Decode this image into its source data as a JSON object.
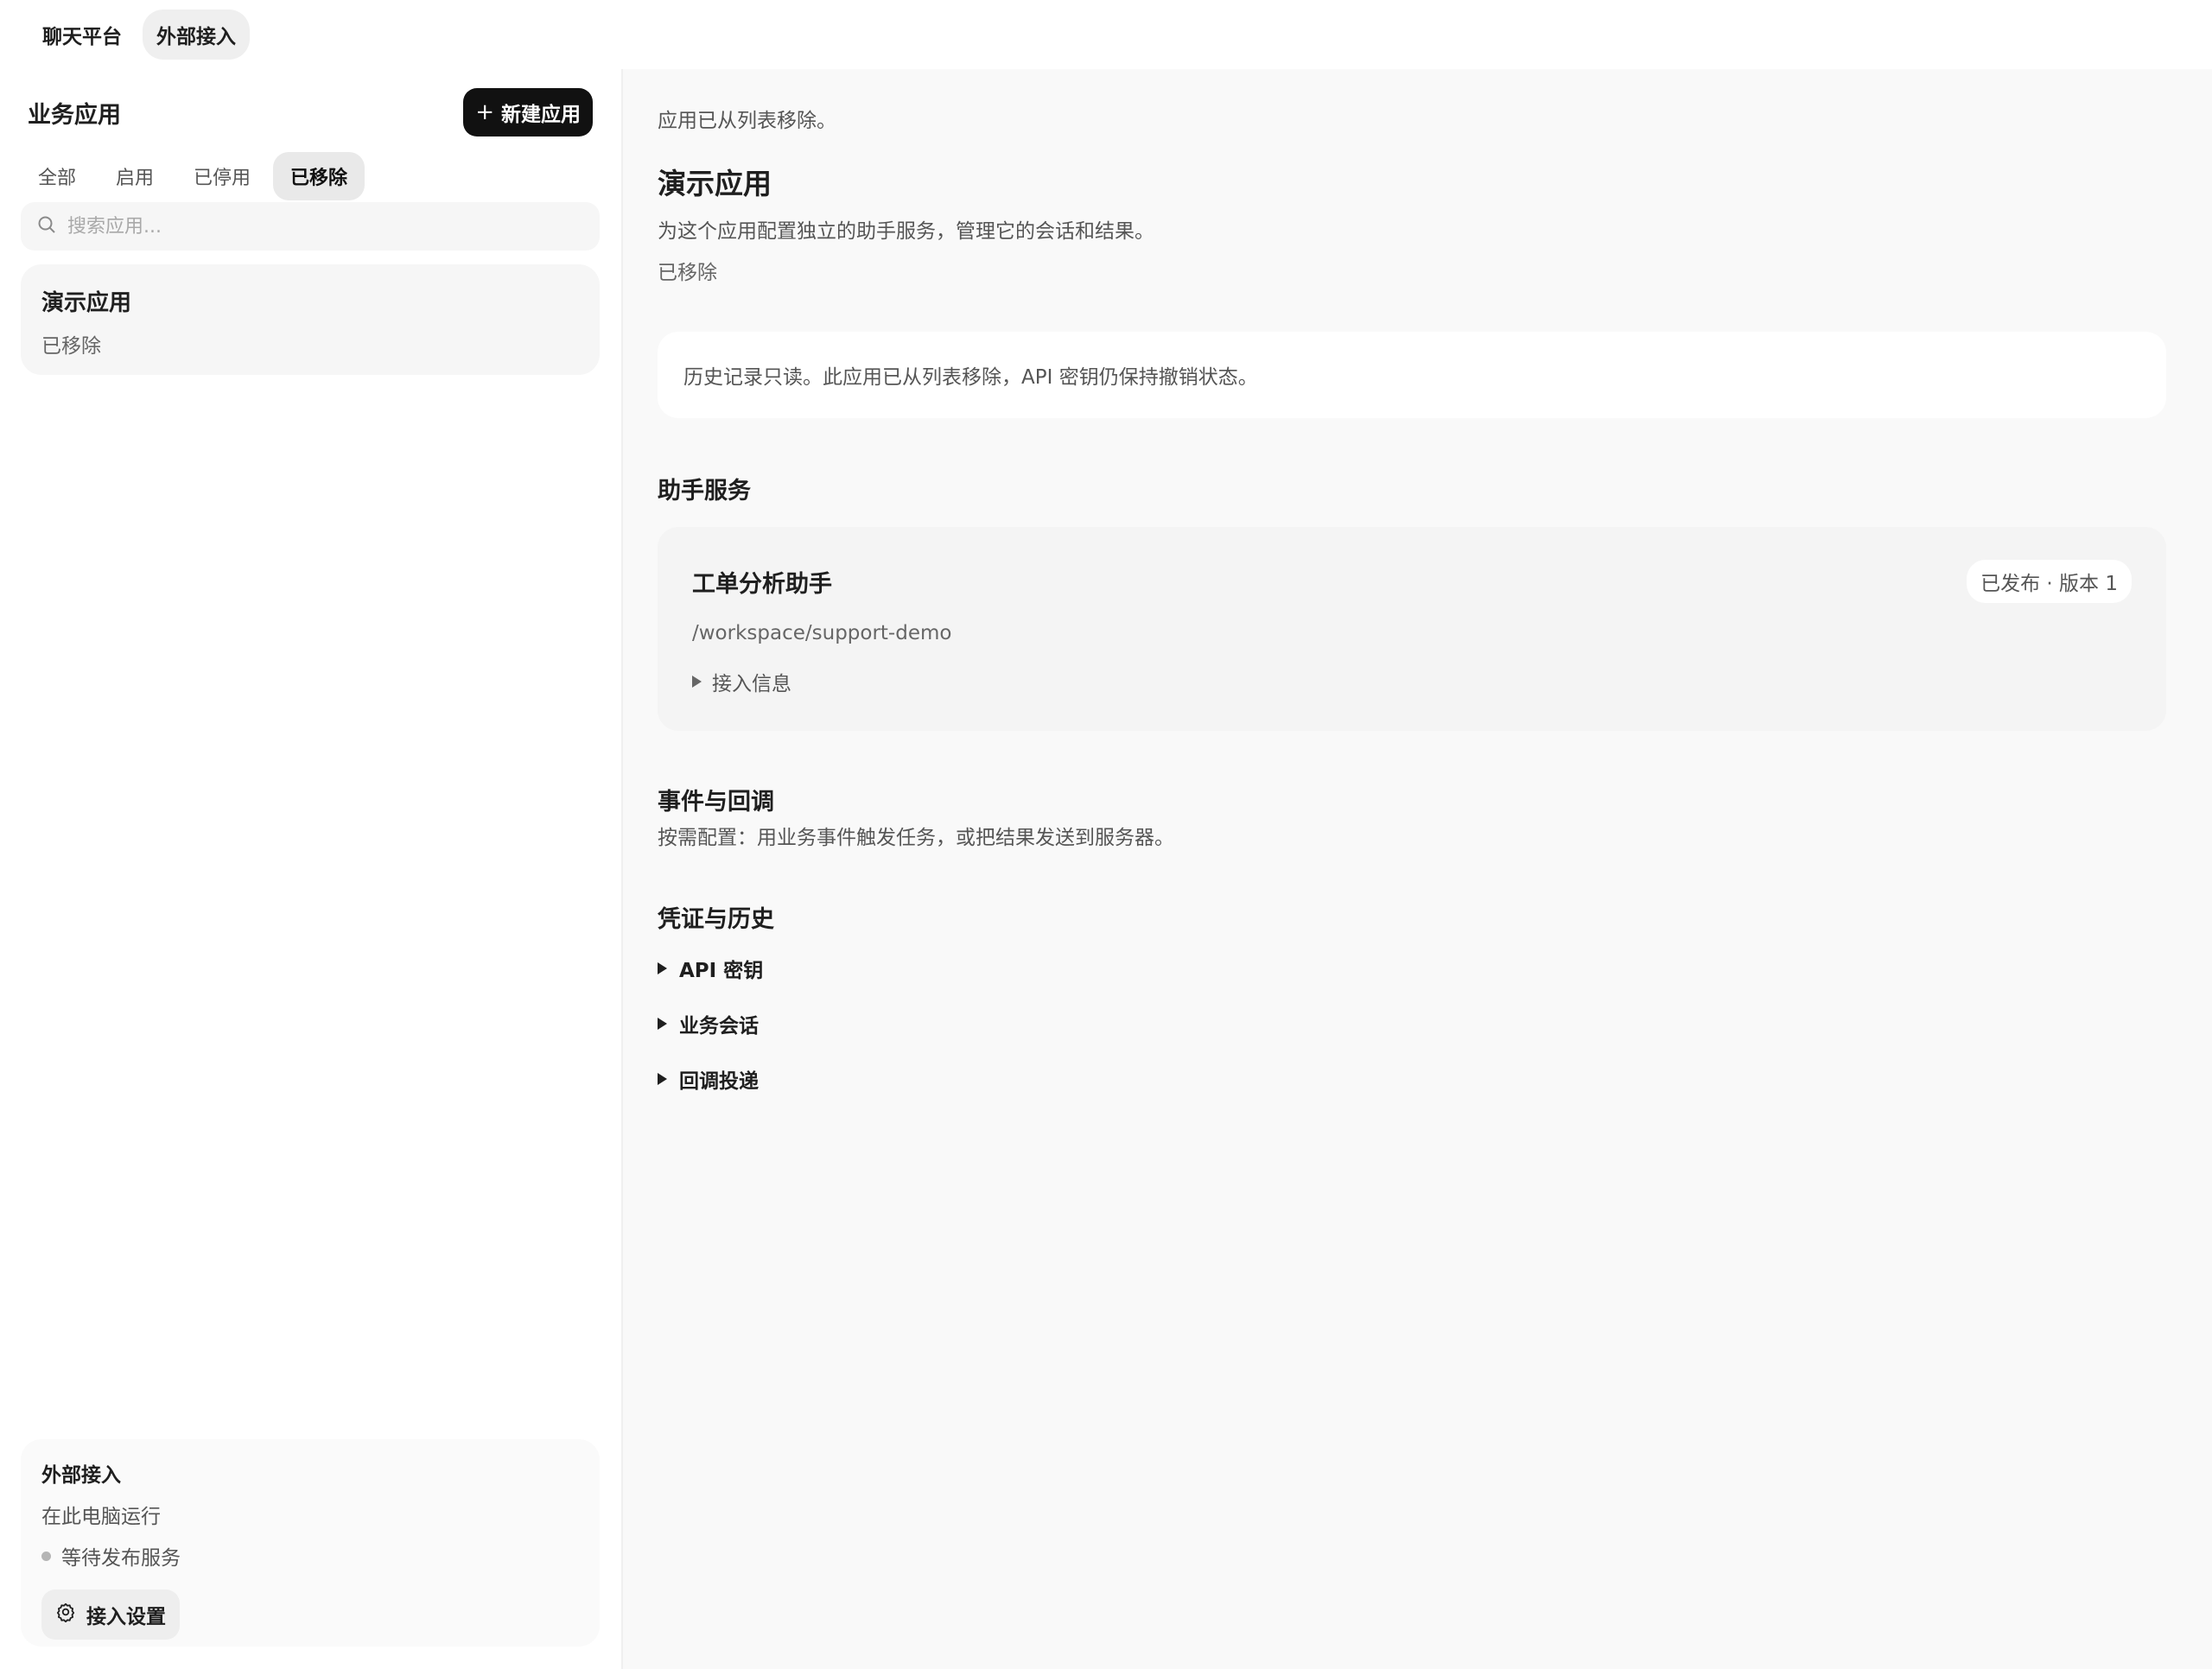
{
  "topnav": {
    "items": [
      {
        "label": "聊天平台"
      },
      {
        "label": "外部接入"
      }
    ]
  },
  "sidebar": {
    "title": "业务应用",
    "new_button": "新建应用",
    "filters": [
      {
        "label": "全部"
      },
      {
        "label": "启用"
      },
      {
        "label": "已停用"
      },
      {
        "label": "已移除"
      }
    ],
    "search_placeholder": "搜索应用...",
    "apps": [
      {
        "name": "演示应用",
        "status": "已移除"
      }
    ],
    "external": {
      "title": "外部接入",
      "subtitle": "在此电脑运行",
      "status": "等待发布服务",
      "settings_button": "接入设置"
    }
  },
  "main": {
    "notice": "应用已从列表移除。",
    "app_title": "演示应用",
    "app_desc": "为这个应用配置独立的助手服务，管理它的会话和结果。",
    "app_status": "已移除",
    "readonly_note": "历史记录只读。此应用已从列表移除，API 密钥仍保持撤销状态。",
    "assistant_section": {
      "title": "助手服务",
      "service": {
        "name": "工单分析助手",
        "badge": "已发布 · 版本 1",
        "path": "/workspace/support-demo",
        "disclosure": "接入信息"
      }
    },
    "events_section": {
      "title": "事件与回调",
      "desc": "按需配置：用业务事件触发任务，或把结果发送到服务器。"
    },
    "credentials_section": {
      "title": "凭证与历史",
      "items": [
        {
          "label": "API 密钥"
        },
        {
          "label": "业务会话"
        },
        {
          "label": "回调投递"
        }
      ]
    }
  }
}
